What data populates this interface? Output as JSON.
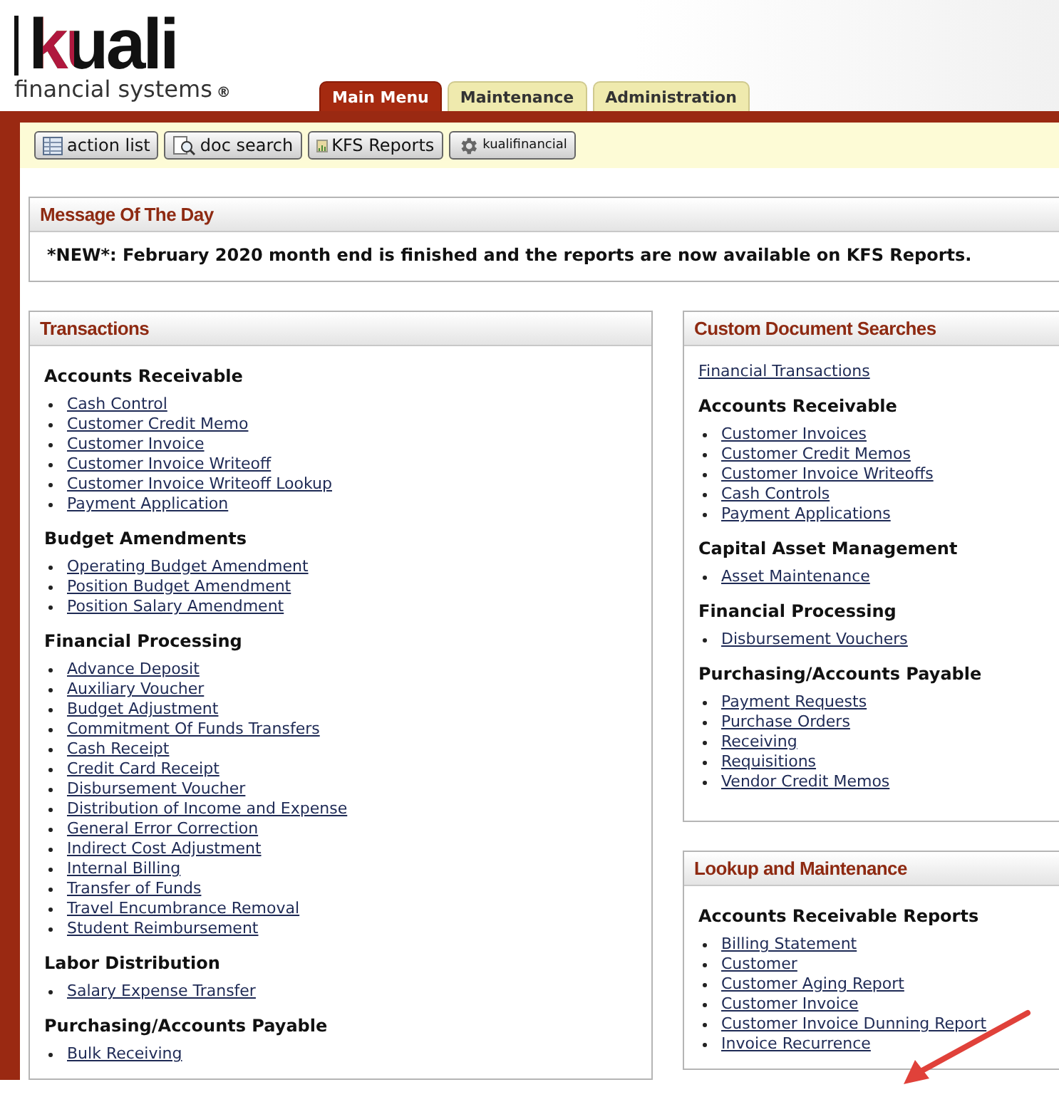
{
  "logo": {
    "wordmark": "kuali",
    "tagline": "financial systems",
    "mark": "®"
  },
  "tabs": [
    {
      "label": "Main Menu",
      "selected": true
    },
    {
      "label": "Maintenance",
      "selected": false
    },
    {
      "label": "Administration",
      "selected": false
    }
  ],
  "toolbar": [
    {
      "label": "action list",
      "kind": "list"
    },
    {
      "label": "doc search",
      "kind": "search"
    },
    {
      "label": "KFS Reports",
      "kind": "reports"
    },
    {
      "label": "kualifinancial",
      "kind": "gear"
    }
  ],
  "message_of_the_day": {
    "title": "Message Of The Day",
    "text": "*NEW*: February 2020 month end is finished and the reports are now available on KFS Reports."
  },
  "transactions": {
    "title": "Transactions",
    "groups": [
      {
        "heading": "Accounts Receivable",
        "links": [
          "Cash Control",
          "Customer Credit Memo",
          "Customer Invoice",
          "Customer Invoice Writeoff",
          "Customer Invoice Writeoff Lookup",
          "Payment Application"
        ]
      },
      {
        "heading": "Budget Amendments",
        "links": [
          "Operating Budget Amendment",
          "Position Budget Amendment",
          "Position Salary Amendment"
        ]
      },
      {
        "heading": "Financial Processing",
        "links": [
          "Advance Deposit",
          "Auxiliary Voucher",
          "Budget Adjustment",
          "Commitment Of Funds Transfers",
          "Cash Receipt",
          "Credit Card Receipt",
          "Disbursement Voucher",
          "Distribution of Income and Expense",
          "General Error Correction",
          "Indirect Cost Adjustment",
          "Internal Billing",
          "Transfer of Funds",
          "Travel Encumbrance Removal",
          "Student Reimbursement"
        ]
      },
      {
        "heading": "Labor Distribution",
        "links": [
          "Salary Expense Transfer"
        ]
      },
      {
        "heading": "Purchasing/Accounts Payable",
        "links": [
          "Bulk Receiving"
        ]
      }
    ]
  },
  "custom_document_searches": {
    "title": "Custom Document Searches",
    "top_link": "Financial Transactions",
    "groups": [
      {
        "heading": "Accounts Receivable",
        "links": [
          "Customer Invoices",
          "Customer Credit Memos",
          "Customer Invoice Writeoffs",
          "Cash Controls",
          "Payment Applications"
        ]
      },
      {
        "heading": "Capital Asset Management",
        "links": [
          "Asset Maintenance"
        ]
      },
      {
        "heading": "Financial Processing",
        "links": [
          "Disbursement Vouchers"
        ]
      },
      {
        "heading": "Purchasing/Accounts Payable",
        "links": [
          "Payment Requests",
          "Purchase Orders",
          "Receiving",
          "Requisitions",
          "Vendor Credit Memos"
        ]
      }
    ]
  },
  "lookup_and_maintenance": {
    "title": "Lookup and Maintenance",
    "groups": [
      {
        "heading": "Accounts Receivable Reports",
        "links": [
          "Billing Statement",
          "Customer",
          "Customer Aging Report",
          "Customer Invoice",
          "Customer Invoice Dunning Report",
          "Invoice Recurrence"
        ]
      }
    ]
  }
}
